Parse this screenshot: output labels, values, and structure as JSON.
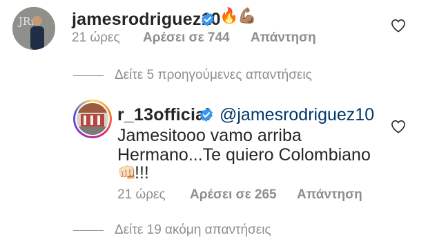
{
  "comment1": {
    "username": "jamesrodriguez10",
    "emojis": [
      "🔥",
      "💪🏽"
    ],
    "time": "21 ώρες",
    "likes": "Αρέσει σε 744",
    "reply": "Απάντηση"
  },
  "view_previous": "Δείτε 5 προηγούμενες απαντήσεις",
  "comment2": {
    "username": "r_13official",
    "mention": "@jamesrodriguez10",
    "text_lines": [
      "Jamesitooo vamo arriba",
      "Hermano...Te quiero Colombiano",
      "!!!"
    ],
    "emoji": "👊🏻",
    "time": "21 ώρες",
    "likes": "Αρέσει σε 265",
    "reply": "Απάντηση"
  },
  "view_more": "Δείτε 19 ακόμη απαντήσεις",
  "colors": {
    "text": "#262626",
    "muted": "#8e8e8e",
    "mention": "#00376b",
    "verified": "#3897f0"
  }
}
